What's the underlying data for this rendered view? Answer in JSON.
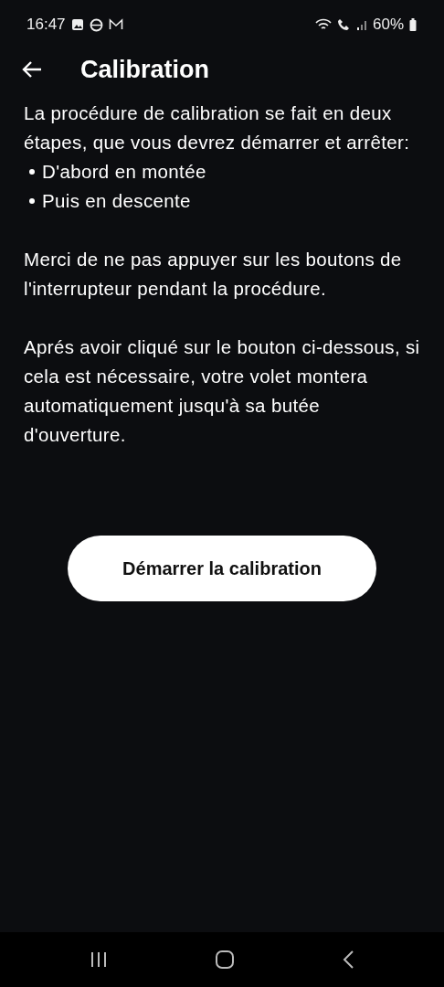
{
  "status_bar": {
    "time": "16:47",
    "battery": "60%"
  },
  "header": {
    "title": "Calibration"
  },
  "intro": "La procédure de calibration se fait en deux étapes, que vous devrez démarrer et arrêter:",
  "steps": [
    "D'abord en montée",
    "Puis en descente"
  ],
  "paragraphs": [
    "Merci de ne pas appuyer sur les boutons de l'interrupteur pendant la procédure.",
    "Aprés avoir cliqué sur le bouton ci-dessous, si cela est nécessaire, votre volet montera automatiquement jusqu'à sa butée d'ouverture."
  ],
  "button": {
    "label": "Démarrer la calibration"
  }
}
